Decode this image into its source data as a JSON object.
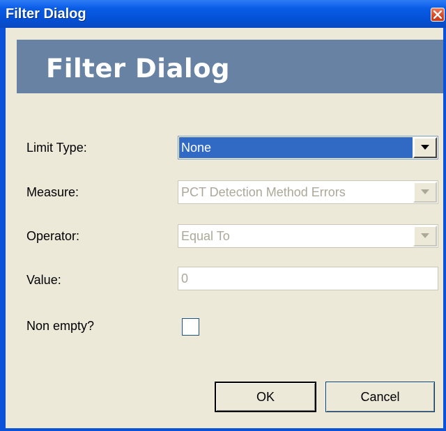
{
  "window": {
    "title": "Filter Dialog",
    "close_icon": "close-icon"
  },
  "banner": {
    "title": "Filter Dialog"
  },
  "form": {
    "limit_type": {
      "label": "Limit Type:",
      "value": "None"
    },
    "measure": {
      "label": "Measure:",
      "value": "PCT Detection Method Errors"
    },
    "operator": {
      "label": "Operator:",
      "value": "Equal To"
    },
    "value_field": {
      "label": "Value:",
      "value": "0"
    },
    "non_empty": {
      "label": "Non empty?",
      "checked": false
    }
  },
  "buttons": {
    "ok": "OK",
    "cancel": "Cancel"
  },
  "colors": {
    "titlebar": "#0450d6",
    "banner": "#6782a3",
    "dialog_bg": "#ece9d8",
    "selection": "#316ac5",
    "disabled_text": "#aca899"
  }
}
